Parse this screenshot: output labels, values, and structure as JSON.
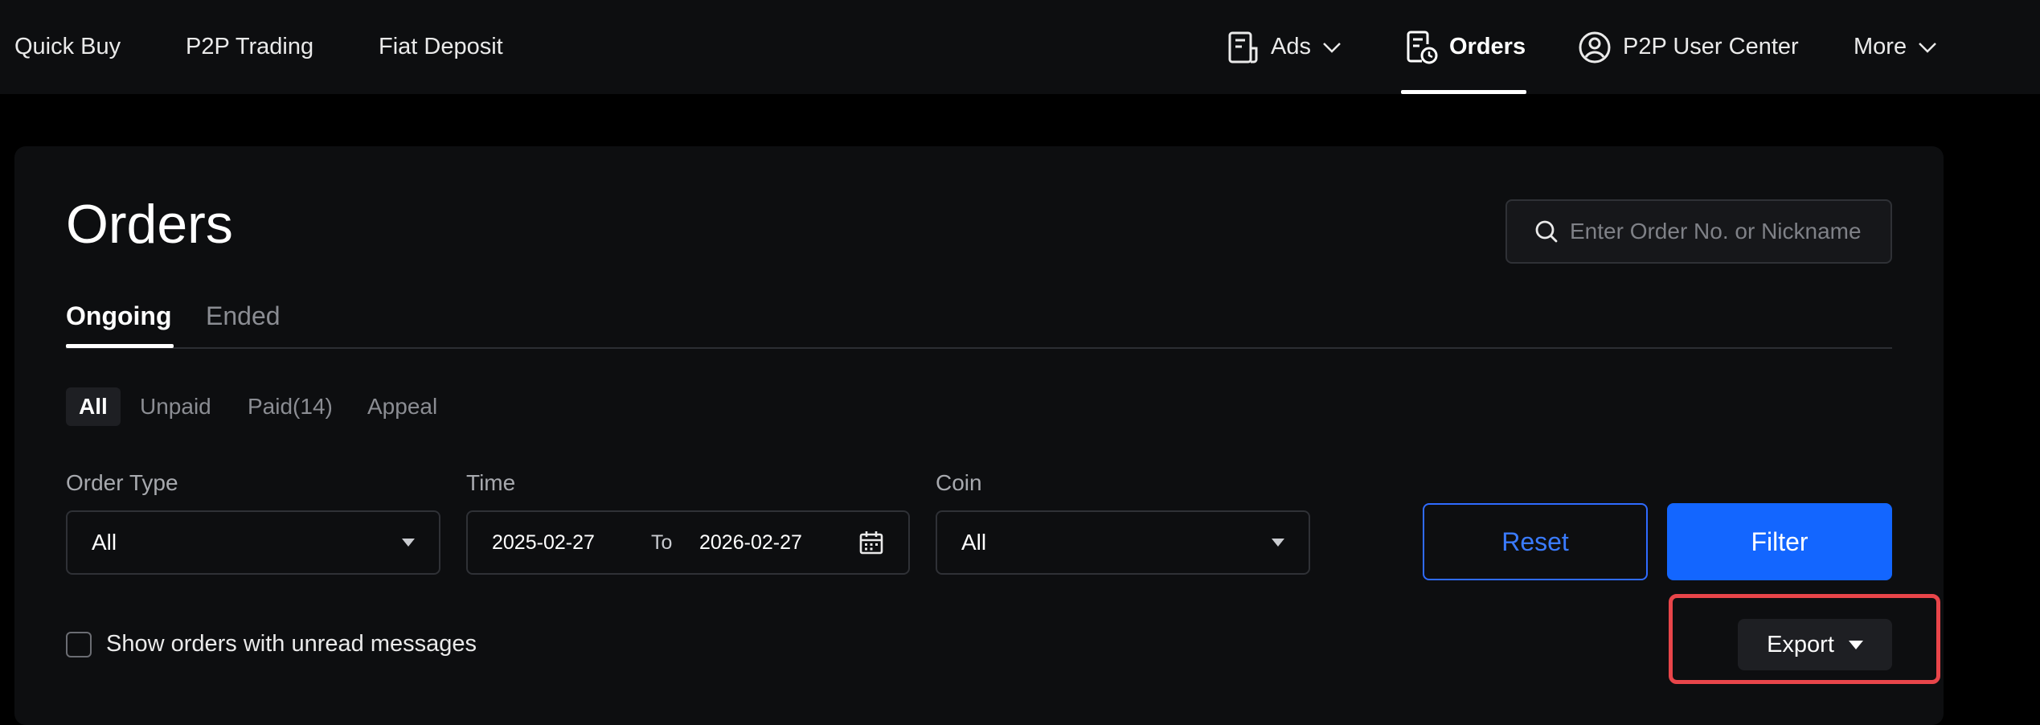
{
  "nav": {
    "quick_buy": "Quick Buy",
    "p2p_trading": "P2P Trading",
    "fiat_deposit": "Fiat Deposit",
    "ads": "Ads",
    "orders": "Orders",
    "user_center": "P2P User Center",
    "more": "More"
  },
  "page": {
    "title": "Orders",
    "search_placeholder": "Enter Order No. or Nickname"
  },
  "tabs": {
    "ongoing": "Ongoing",
    "ended": "Ended"
  },
  "subtabs": {
    "all": "All",
    "unpaid": "Unpaid",
    "paid": "Paid(14)",
    "appeal": "Appeal"
  },
  "filters": {
    "order_type_label": "Order Type",
    "order_type_value": "All",
    "time_label": "Time",
    "date_from": "2025-02-27",
    "date_to_sep": "To",
    "date_to": "2026-02-27",
    "coin_label": "Coin",
    "coin_value": "All",
    "reset": "Reset",
    "filter": "Filter"
  },
  "options": {
    "unread_messages": "Show orders with unread messages",
    "export": "Export"
  },
  "colors": {
    "accent_blue": "#1366ff",
    "highlight_red": "#e8454a"
  }
}
